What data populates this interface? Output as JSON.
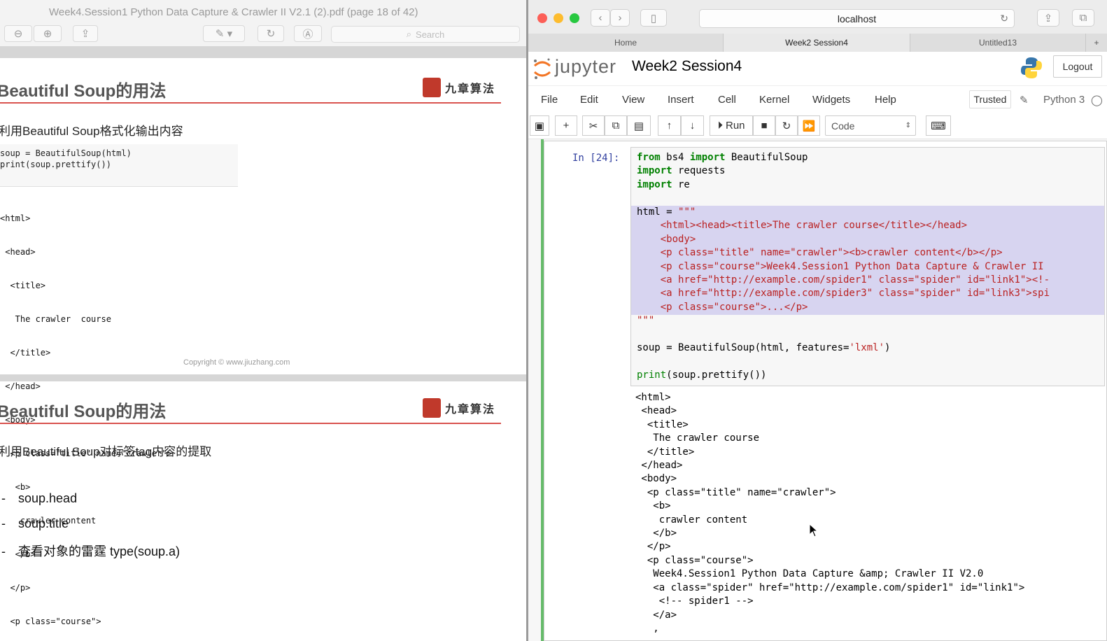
{
  "pdf": {
    "title": "Week4.Session1 Python Data Capture & Crawler II V2.1 (2).pdf (page 18 of 42)",
    "search_placeholder": "Search",
    "slide1": {
      "heading": "Beautiful Soup的用法",
      "logo_text": "九章算法",
      "subheading": "利用Beautiful Soup格式化输出内容",
      "code": [
        "soup = BeautifulSoup(html)",
        "print(soup.prettify())"
      ],
      "output": [
        "<html>",
        " <head>",
        "  <title>",
        "   The crawler  course",
        "  </title>",
        " </head>",
        " <body>",
        "  <p class=\"title\" name=\"crawler\">",
        "   <b>",
        "    crawler content",
        "   </b>",
        "  </p>",
        "  <p class=\"course\">"
      ],
      "copyright": "Copyright © www.jiuzhang.com"
    },
    "slide2": {
      "heading": "Beautiful Soup的用法",
      "logo_text": "九章算法",
      "subheading": "利用Beautiful Soup对标签tag内容的提取",
      "bullets": [
        "soup.head",
        "soup.title",
        "查看对象的雷霆  type(soup.a)"
      ]
    }
  },
  "browser": {
    "address": "localhost",
    "tabs": [
      "Home",
      "Week2 Session4",
      "Untitled13"
    ],
    "active_tab": 1
  },
  "jupyter": {
    "logo_text": "jupyter",
    "notebook_name": "Week2 Session4",
    "logout_label": "Logout",
    "menu": [
      "File",
      "Edit",
      "View",
      "Insert",
      "Cell",
      "Kernel",
      "Widgets",
      "Help"
    ],
    "trusted_label": "Trusted",
    "kernel_name": "Python 3",
    "run_label": "Run",
    "cell_type": "Code",
    "prompt": "In [24]:",
    "code": {
      "l1_kw1": "from",
      "l1_mid": " bs4 ",
      "l1_kw2": "import",
      "l1_rest": " BeautifulSoup",
      "l2_kw": "import",
      "l2_rest": " requests",
      "l3_kw": "import",
      "l3_rest": " re",
      "html_assign": "html = ",
      "html_open": "\"\"\"",
      "html_lines": [
        "    <html><head><title>The crawler course</title></head>",
        "    <body>",
        "    <p class=\"title\" name=\"crawler\"><b>crawler content</b></p>",
        "    <p class=\"course\">Week4.Session1 Python Data Capture & Crawler II",
        "    <a href=\"http://example.com/spider1\" class=\"spider\" id=\"link1\"><!-",
        "    <a href=\"http://example.com/spider3\" class=\"spider\" id=\"link3\">spi",
        "    <p class=\"course\">...</p>"
      ],
      "html_close": "\"\"\"",
      "soup_pre": "soup = BeautifulSoup(html, features=",
      "soup_str": "'lxml'",
      "soup_post": ")",
      "print_kw": "print",
      "print_rest": "(soup.prettify())"
    },
    "output": [
      "<html>",
      " <head>",
      "  <title>",
      "   The crawler course",
      "  </title>",
      " </head>",
      " <body>",
      "  <p class=\"title\" name=\"crawler\">",
      "   <b>",
      "    crawler content",
      "   </b>",
      "  </p>",
      "  <p class=\"course\">",
      "   Week4.Session1 Python Data Capture &amp; Crawler II V2.0",
      "   <a class=\"spider\" href=\"http://example.com/spider1\" id=\"link1\">",
      "    <!-- spider1 -->",
      "   </a>",
      "   ,"
    ]
  },
  "colors": {
    "cell_selected_bar": "#66bb6a",
    "slide_rule": "#d9534f",
    "keyword": "#008000",
    "string": "#ba2121",
    "prompt": "#303f9f",
    "jupyter_orange": "#f37626"
  }
}
